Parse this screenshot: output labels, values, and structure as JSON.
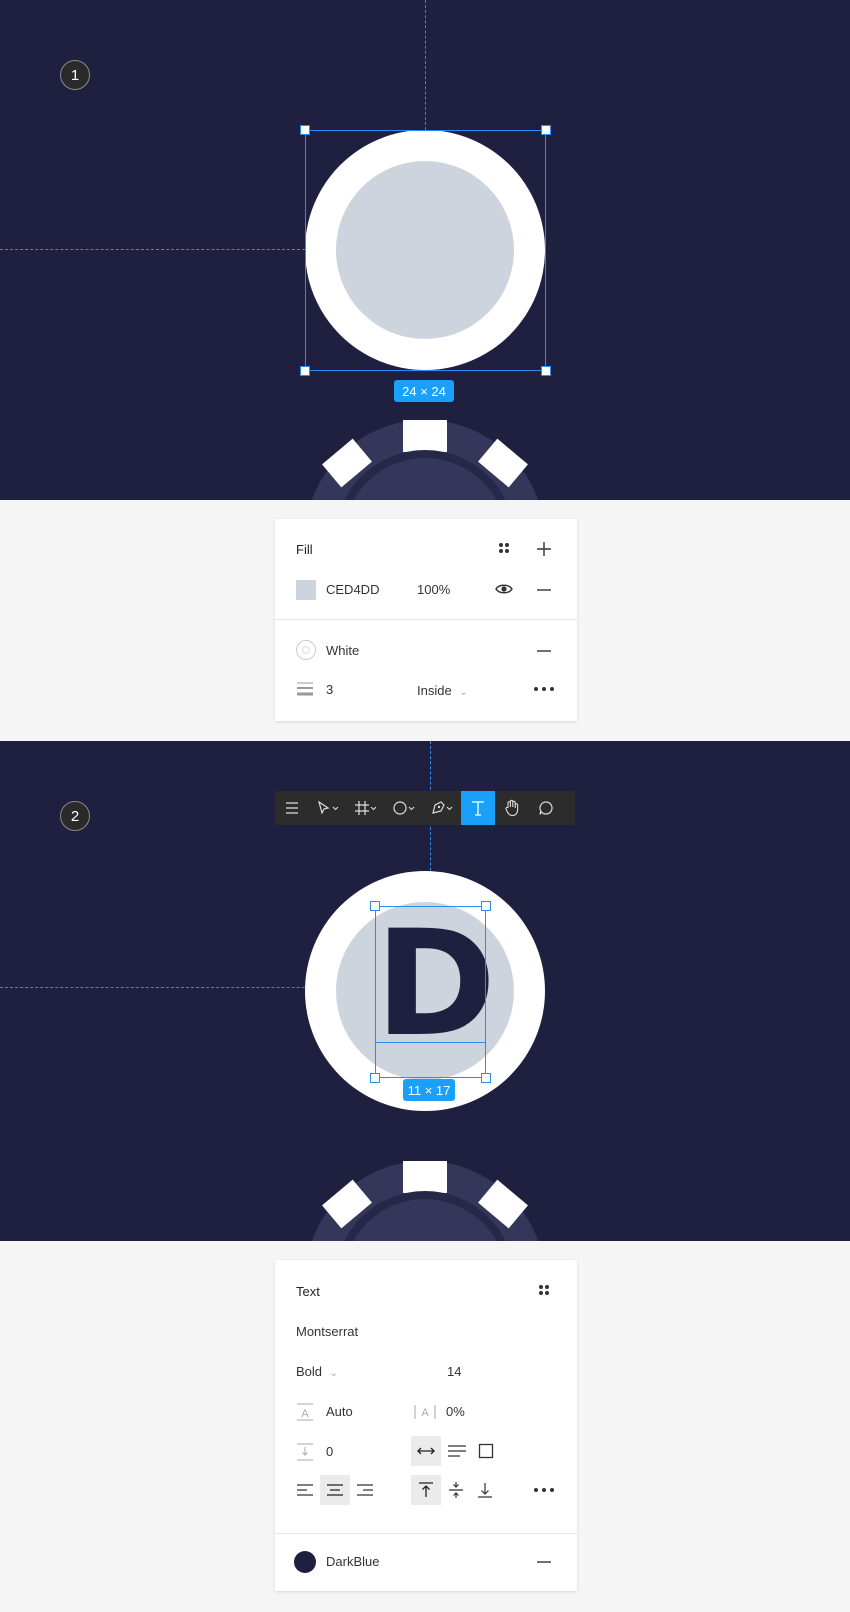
{
  "step1": {
    "badge": "1",
    "size_label": "24 × 24",
    "fill_panel": {
      "title": "Fill",
      "fill_hex": "CED4DD",
      "fill_opacity": "100%",
      "stroke_color_name": "White",
      "stroke_width": "3",
      "stroke_position": "Inside"
    }
  },
  "step2": {
    "badge": "2",
    "letter": "D",
    "size_label": "11 × 17",
    "toolbar": {
      "active_tool": "text-tool"
    },
    "text_panel": {
      "title": "Text",
      "font_family": "Montserrat",
      "font_weight": "Bold",
      "font_size": "14",
      "line_height": "Auto",
      "letter_spacing": "0%",
      "paragraph_spacing": "0",
      "color_name": "DarkBlue"
    }
  },
  "colors": {
    "canvas_bg": "#1f1f40",
    "fill": "#CED4DD",
    "stroke": "#FFFFFF",
    "darkblue": "#1F1F40",
    "selection": "#18A0FB"
  }
}
